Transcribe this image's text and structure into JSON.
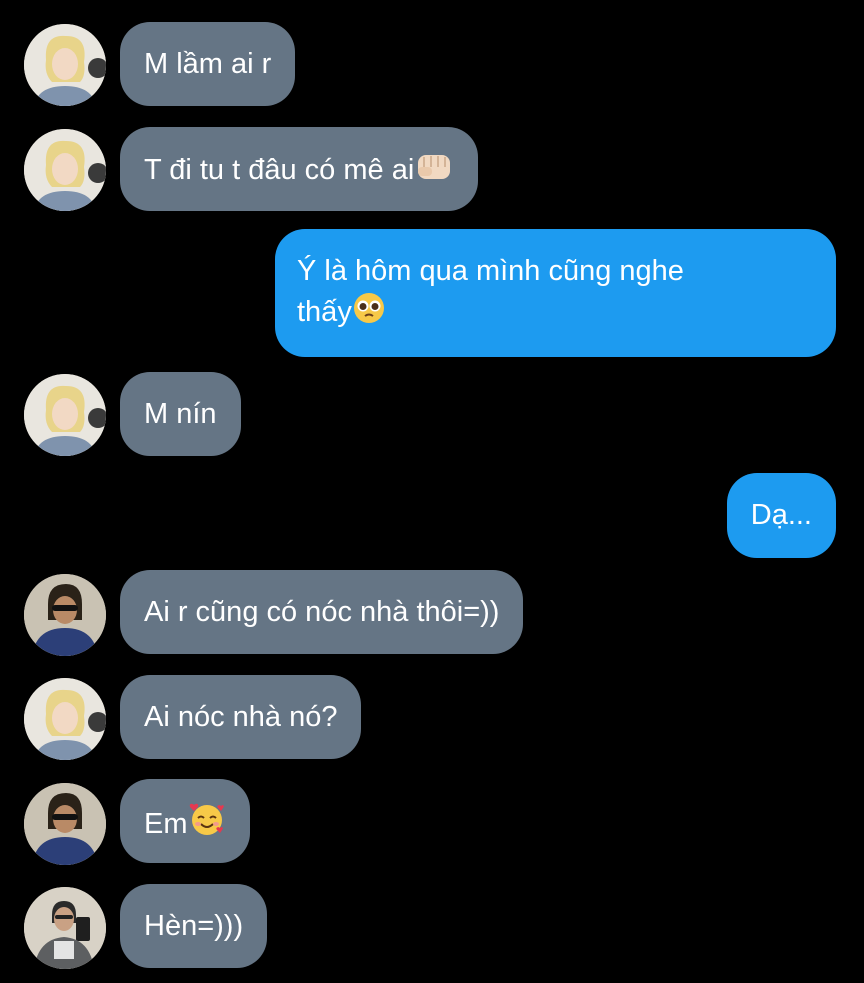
{
  "colors": {
    "background": "#000000",
    "incoming_bubble": "#657585",
    "outgoing_bubble": "#1d9bf0",
    "text": "#ffffff"
  },
  "messages": [
    {
      "side": "in",
      "avatar": "blonde-avatar",
      "text": "M lầm ai r",
      "emoji": ""
    },
    {
      "side": "in",
      "avatar": "blonde-avatar",
      "text": "T đi tu t đâu có mê ai",
      "emoji": "fist-emoji"
    },
    {
      "side": "out",
      "text_line1": "Ý là hôm qua mình cũng nghe",
      "text_line2": "thấy",
      "emoji": "pleading-face-emoji"
    },
    {
      "side": "in",
      "avatar": "blonde-avatar",
      "text": "M nín",
      "emoji": ""
    },
    {
      "side": "out",
      "text": "Dạ...",
      "emoji": ""
    },
    {
      "side": "in",
      "avatar": "sunglasses-avatar",
      "text": "Ai r cũng có nóc nhà thôi=))",
      "emoji": ""
    },
    {
      "side": "in",
      "avatar": "blonde-avatar",
      "text": "Ai nóc nhà nó?",
      "emoji": ""
    },
    {
      "side": "in",
      "avatar": "sunglasses-avatar",
      "text": "Em",
      "emoji": "smiling-face-with-hearts-emoji"
    },
    {
      "side": "in",
      "avatar": "selfie-avatar",
      "text": "Hèn=)))",
      "emoji": ""
    }
  ]
}
